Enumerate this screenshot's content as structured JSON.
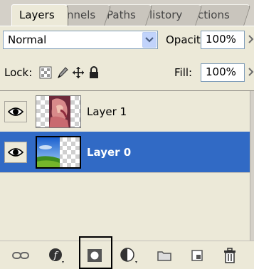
{
  "tabs": [
    {
      "label": "Layers",
      "active": true
    },
    {
      "label": "nnels",
      "active": false
    },
    {
      "label": "Paths",
      "active": false
    },
    {
      "label": "listory",
      "active": false
    },
    {
      "label": "ctions",
      "active": false
    }
  ],
  "blend_mode": {
    "value": "Normal"
  },
  "opacity": {
    "label": "Opacity:",
    "value": "100%"
  },
  "lock": {
    "label": "Lock:",
    "icons": [
      "lock-transparent-icon",
      "lock-image-icon",
      "lock-position-icon",
      "lock-all-icon"
    ]
  },
  "fill": {
    "label": "Fill:",
    "value": "100%"
  },
  "layers": [
    {
      "name": "Layer 1",
      "visible": true,
      "selected": false
    },
    {
      "name": "Layer 0",
      "visible": true,
      "selected": true
    }
  ],
  "toolbar_icons": [
    "link-layers-icon",
    "layer-style-icon",
    "add-mask-icon",
    "adjustment-layer-icon",
    "new-group-icon",
    "new-layer-icon",
    "delete-layer-icon"
  ],
  "colors": {
    "selection": "#316ac5",
    "panel": "#ece9d8"
  }
}
